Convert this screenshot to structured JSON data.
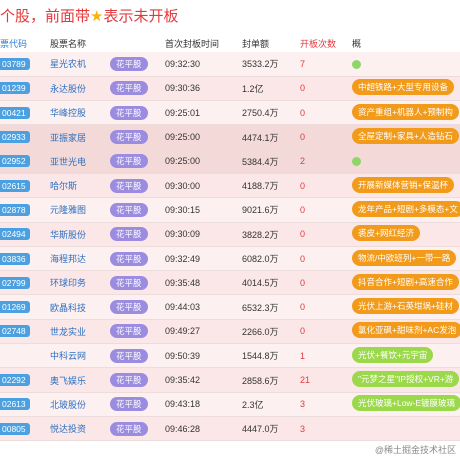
{
  "title": {
    "prefix": "个股，前面带",
    "star": "★",
    "suffix": "表示未开板"
  },
  "headers": {
    "code": "票代码",
    "name": "股票名称",
    "tag": "",
    "time": "首次封板时间",
    "amount": "封单额",
    "count": "开板次数",
    "concept": "概"
  },
  "rows": [
    {
      "code": "03789",
      "name": "星光农机",
      "tag": "花平股",
      "time": "09:32:30",
      "amount": "3533.2万",
      "count": "7",
      "concept": "",
      "concept_style": "dot"
    },
    {
      "code": "01239",
      "name": "永达股份",
      "tag": "花平股",
      "time": "09:30:36",
      "amount": "1.2亿",
      "count": "0",
      "concept": "中超铁路+大型专用设备",
      "concept_style": "orange"
    },
    {
      "code": "00421",
      "name": "华峰控股",
      "tag": "花平股",
      "time": "09:25:01",
      "amount": "2750.4万",
      "count": "0",
      "concept": "资产重组+机器人+预制构",
      "concept_style": "orange"
    },
    {
      "code": "02933",
      "name": "亚振家居",
      "tag": "花平股",
      "time": "09:25:00",
      "amount": "4474.1万",
      "count": "0",
      "concept": "全屋定制+家具+人造钻石",
      "concept_style": "orange"
    },
    {
      "code": "02952",
      "name": "亚世光电",
      "tag": "花平股",
      "time": "09:25:00",
      "amount": "5384.4万",
      "count": "2",
      "concept": "",
      "concept_style": "dot"
    },
    {
      "code": "02615",
      "name": "哈尔斯",
      "tag": "花平股",
      "time": "09:30:00",
      "amount": "4188.7万",
      "count": "0",
      "concept": "开展新媒体营销+保温杯",
      "concept_style": "orange"
    },
    {
      "code": "02878",
      "name": "元隆雅图",
      "tag": "花平股",
      "time": "09:30:15",
      "amount": "9021.6万",
      "count": "0",
      "concept": "龙年产品+短剧+多模态+文",
      "concept_style": "orange"
    },
    {
      "code": "02494",
      "name": "华斯股份",
      "tag": "花平股",
      "time": "09:30:09",
      "amount": "3828.2万",
      "count": "0",
      "concept": "裘皮+网红经济",
      "concept_style": "orange"
    },
    {
      "code": "03836",
      "name": "海程邦达",
      "tag": "花平股",
      "time": "09:32:49",
      "amount": "6082.0万",
      "count": "0",
      "concept": "物流/中欧班列+一带一路",
      "concept_style": "orange"
    },
    {
      "code": "02799",
      "name": "环球印务",
      "tag": "花平股",
      "time": "09:35:48",
      "amount": "4014.5万",
      "count": "0",
      "concept": "抖音合作+短剧+高速合作",
      "concept_style": "orange"
    },
    {
      "code": "01269",
      "name": "欧晶科技",
      "tag": "花平股",
      "time": "09:44:03",
      "amount": "6532.3万",
      "count": "0",
      "concept": "光伏上游+石英坩埚+硅材",
      "concept_style": "orange"
    },
    {
      "code": "02748",
      "name": "世龙实业",
      "tag": "花平股",
      "time": "09:49:27",
      "amount": "2266.0万",
      "count": "0",
      "concept": "氯化亚砜+甜味剂+AC发泡",
      "concept_style": "orange"
    },
    {
      "code": "",
      "name": "中科云网",
      "tag": "花平股",
      "time": "09:50:39",
      "amount": "1544.8万",
      "count": "1",
      "concept": "光伏+餐饮+元宇宙",
      "concept_style": "green"
    },
    {
      "code": "02292",
      "name": "奥飞娱乐",
      "tag": "花平股",
      "time": "09:35:42",
      "amount": "2858.6万",
      "count": "21",
      "concept": "\"元梦之星\"IP授权+VR+游",
      "concept_style": "green"
    },
    {
      "code": "02613",
      "name": "北玻股份",
      "tag": "花平股",
      "time": "09:43:18",
      "amount": "2.3亿",
      "count": "3",
      "concept": "光伏玻璃+Low-E镀膜玻璃",
      "concept_style": "green"
    },
    {
      "code": "00805",
      "name": "悦达投资",
      "tag": "花平股",
      "time": "09:46:28",
      "amount": "4447.0万",
      "count": "3",
      "concept": "",
      "concept_style": "none"
    }
  ],
  "watermark": "@稀土掘金技术社区"
}
